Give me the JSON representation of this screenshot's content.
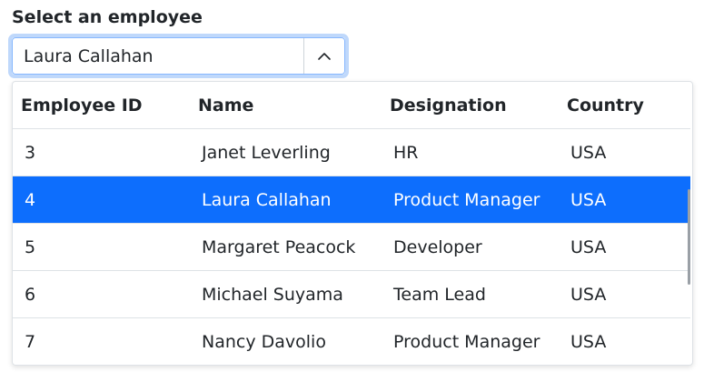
{
  "label": "Select an employee",
  "combo": {
    "value": "Laura Callahan",
    "toggle_icon": "chevron-up-icon"
  },
  "table": {
    "headers": [
      "Employee ID",
      "Name",
      "Designation",
      "Country"
    ],
    "rows": [
      {
        "id": "3",
        "name": "Janet Leverling",
        "designation": "HR",
        "country": "USA",
        "selected": false
      },
      {
        "id": "4",
        "name": "Laura Callahan",
        "designation": "Product Manager",
        "country": "USA",
        "selected": true
      },
      {
        "id": "5",
        "name": "Margaret Peacock",
        "designation": "Developer",
        "country": "USA",
        "selected": false
      },
      {
        "id": "6",
        "name": "Michael Suyama",
        "designation": "Team Lead",
        "country": "USA",
        "selected": false
      },
      {
        "id": "7",
        "name": "Nancy Davolio",
        "designation": "Product Manager",
        "country": "USA",
        "selected": false
      }
    ]
  },
  "colors": {
    "selected_bg": "#0d6efd",
    "focus_ring": "#bfd8fb"
  }
}
